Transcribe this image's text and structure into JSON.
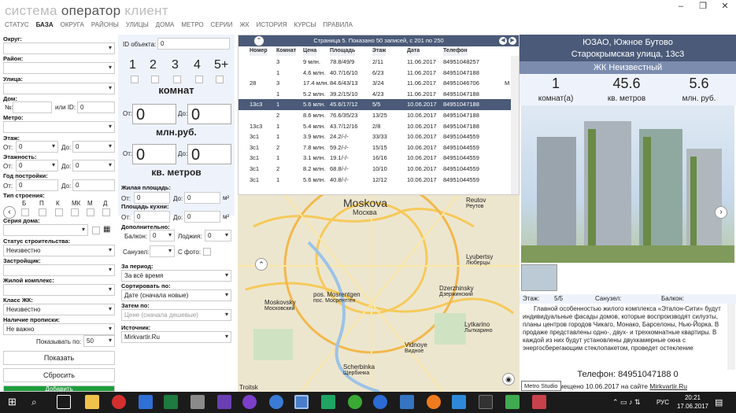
{
  "app": {
    "title1": "система",
    "title2": "оператор",
    "title3": "клиент"
  },
  "menu": [
    "СТАТУС",
    "БАЗА",
    "ОКРУГА",
    "РАЙОНЫ",
    "УЛИЦЫ",
    "ДОМА",
    "МЕТРО",
    "СЕРИИ",
    "ЖК",
    "ИСТОРИЯ",
    "КУРСЫ",
    "ПРАВИЛА"
  ],
  "filters": {
    "okrug": "Округ:",
    "rayon": "Район:",
    "ulica": "Улица:",
    "dom": "Дом:",
    "no": "№:",
    "or_id": "или ID:",
    "id_val": "0",
    "no_val": "",
    "metro": "Метро:",
    "etazh": "Этаж:",
    "ot": "От:",
    "do": "До:",
    "etazh_from": "0",
    "etazh_to": "0",
    "etazhnost": "Этажность:",
    "etazhnost_from": "0",
    "etazhnost_to": "0",
    "god": "Год постройки:",
    "god_from": "0",
    "god_to": "0",
    "tip": "Тип строения:",
    "tip_opts": [
      "Б",
      "П",
      "К",
      "МК",
      "М",
      "Д"
    ],
    "seria": "Серия дома:",
    "status": "Статус строительства:",
    "status_val": "Неизвестно",
    "zastr": "Застройщик:",
    "zhk": "Жилой комплекс:",
    "klass": "Класс ЖК:",
    "klass_val": "Неизвестно",
    "propiska": "Наличие прописки:",
    "propiska_val": "Не важно",
    "show_by": "Показывать по:",
    "show_by_val": "50",
    "show_btn": "Показать",
    "reset_btn": "Сбросить",
    "add_btn": "Добавить"
  },
  "mid": {
    "object_id_label": "ID объекта:",
    "object_id_val": "0",
    "rooms": [
      "1",
      "2",
      "3",
      "4",
      "5+"
    ],
    "rooms_label": "комнат",
    "price_from": "0",
    "price_to": "0",
    "price_label": "млн.руб.",
    "area_from": "0",
    "area_to": "0",
    "area_label": "кв. метров",
    "ot": "От:",
    "do": "До:",
    "live_area": "Жилая площадь:",
    "kitchen_area": "Площадь кухни:",
    "live_from": "0",
    "live_to": "0",
    "kitchen_from": "0",
    "kitchen_to": "0",
    "m2": "м²",
    "extra": "Дополнительно:",
    "balcony": "Балкон:",
    "balcony_val": "0",
    "loggia": "Лоджия:",
    "loggia_val": "0",
    "sanuzel": "Санузел:",
    "photo": "С фото:",
    "period_label": "За период:",
    "period_val": "За всё время",
    "sort_label": "Сортировать по:",
    "sort_val": "Дате (сначала новые)",
    "then_label": "Затем по:",
    "then_val": "Цене (сначала дешевые)",
    "source_label": "Источник:",
    "source_val": "Mirkvartir.Ru"
  },
  "grid": {
    "header": "Страница 5. Показано 50 записей, с 201 по 250",
    "columns": [
      "Номер",
      "Комнат",
      "Цена",
      "Площадь",
      "Этаж",
      "Дата",
      "Телефон"
    ],
    "rows": [
      [
        "",
        "3",
        "9 млн.",
        "78.8/49/9",
        "2/11",
        "11.06.2017",
        "84951048257",
        ""
      ],
      [
        "",
        "1",
        "4.6 млн.",
        "40.7/16/10",
        "6/23",
        "11.06.2017",
        "84951047188",
        ""
      ],
      [
        "28",
        "3",
        "17.4 млн.",
        "84.6/43/13",
        "3/24",
        "11.06.2017",
        "84951046706",
        "M"
      ],
      [
        "",
        "1",
        "5.2 млн.",
        "39.2/15/10",
        "4/23",
        "11.06.2017",
        "84951047188",
        ""
      ],
      [
        "13с3",
        "1",
        "5.6 млн.",
        "45.6/17/12",
        "5/5",
        "10.06.2017",
        "84951047188",
        ""
      ],
      [
        "",
        "2",
        "8.6 млн.",
        "76.6/35/23",
        "13/25",
        "10.06.2017",
        "84951047188",
        ""
      ],
      [
        "13с3",
        "1",
        "5.4 млн.",
        "43.7/12/16",
        "2/8",
        "10.06.2017",
        "84951047188",
        ""
      ],
      [
        "3с1",
        "1",
        "3.9 млн.",
        "24.2/-/-",
        "33/33",
        "10.06.2017",
        "84951044559",
        ""
      ],
      [
        "3с1",
        "2",
        "7.8 млн.",
        "59.2/-/-",
        "15/15",
        "10.06.2017",
        "84951044559",
        ""
      ],
      [
        "3с1",
        "1",
        "3.1 млн.",
        "19.1/-/-",
        "16/16",
        "10.06.2017",
        "84951044559",
        ""
      ],
      [
        "3с1",
        "2",
        "8.2 млн.",
        "68.8/-/-",
        "10/10",
        "10.06.2017",
        "84951044559",
        ""
      ],
      [
        "3с1",
        "1",
        "5.6 млн.",
        "40.8/-/-",
        "12/12",
        "10.06.2017",
        "84951044559",
        ""
      ]
    ]
  },
  "map": {
    "city": "Moskova",
    "city_ru": "Москва",
    "labels": [
      "Reutov",
      "Реутов",
      "Lyubertsy",
      "Люберцы",
      "Dzerzhinsky",
      "Дзержинский",
      "Lytkarino",
      "Лыткарино",
      "Vidnoye",
      "Видное",
      "Moskovsky",
      "Московский",
      "pos. Mosrentgen",
      "пос. Мосрентген",
      "Scherbinka",
      "Щербинка",
      "Troitsk",
      "pos. Ryazanovskiy",
      "посёлок Рязановский",
      "Ostafyevo",
      "Sosenskoye",
      "пос. Сосенское",
      "Kommunarka"
    ]
  },
  "detail": {
    "district": "ЮЗАО, Южное Бутово",
    "address": "Старокрымская улица, 13с3",
    "complex": "ЖК Неизвестный",
    "rooms_val": "1",
    "rooms_lbl": "комнат(а)",
    "area_val": "45.6",
    "area_lbl": "кв. метров",
    "price_val": "5.6",
    "price_lbl": "млн. руб.",
    "floor_lbl": "Этаж:",
    "floor_val": "5/5",
    "sanuzel_lbl": "Санузел:",
    "balcony_lbl": "Балкон:",
    "description": "Главной особенностью жилого комплекса «Эталон-Сити» будут индивидуальные фасады домов, которые воспроизводят силуэты, планы центров городов Чикаго, Монако, Барселоны, Нью-Йорка. В продаже представлены одно-, двух- и трехкомнатные квартиры. В каждой из них будут установлены двухкамерные окна с энергосберегающим стеклопакетом, проведет остекление",
    "phone": "Телефон: 84951047188 0",
    "posted_prefix": "мещено 10.06.2017 на сайте",
    "posted_site": "Mirkvartir.Ru",
    "tooltip": "Metro Studio"
  },
  "taskbar": {
    "lang": "РУС",
    "time": "20:21",
    "date": "17.06.2017"
  }
}
